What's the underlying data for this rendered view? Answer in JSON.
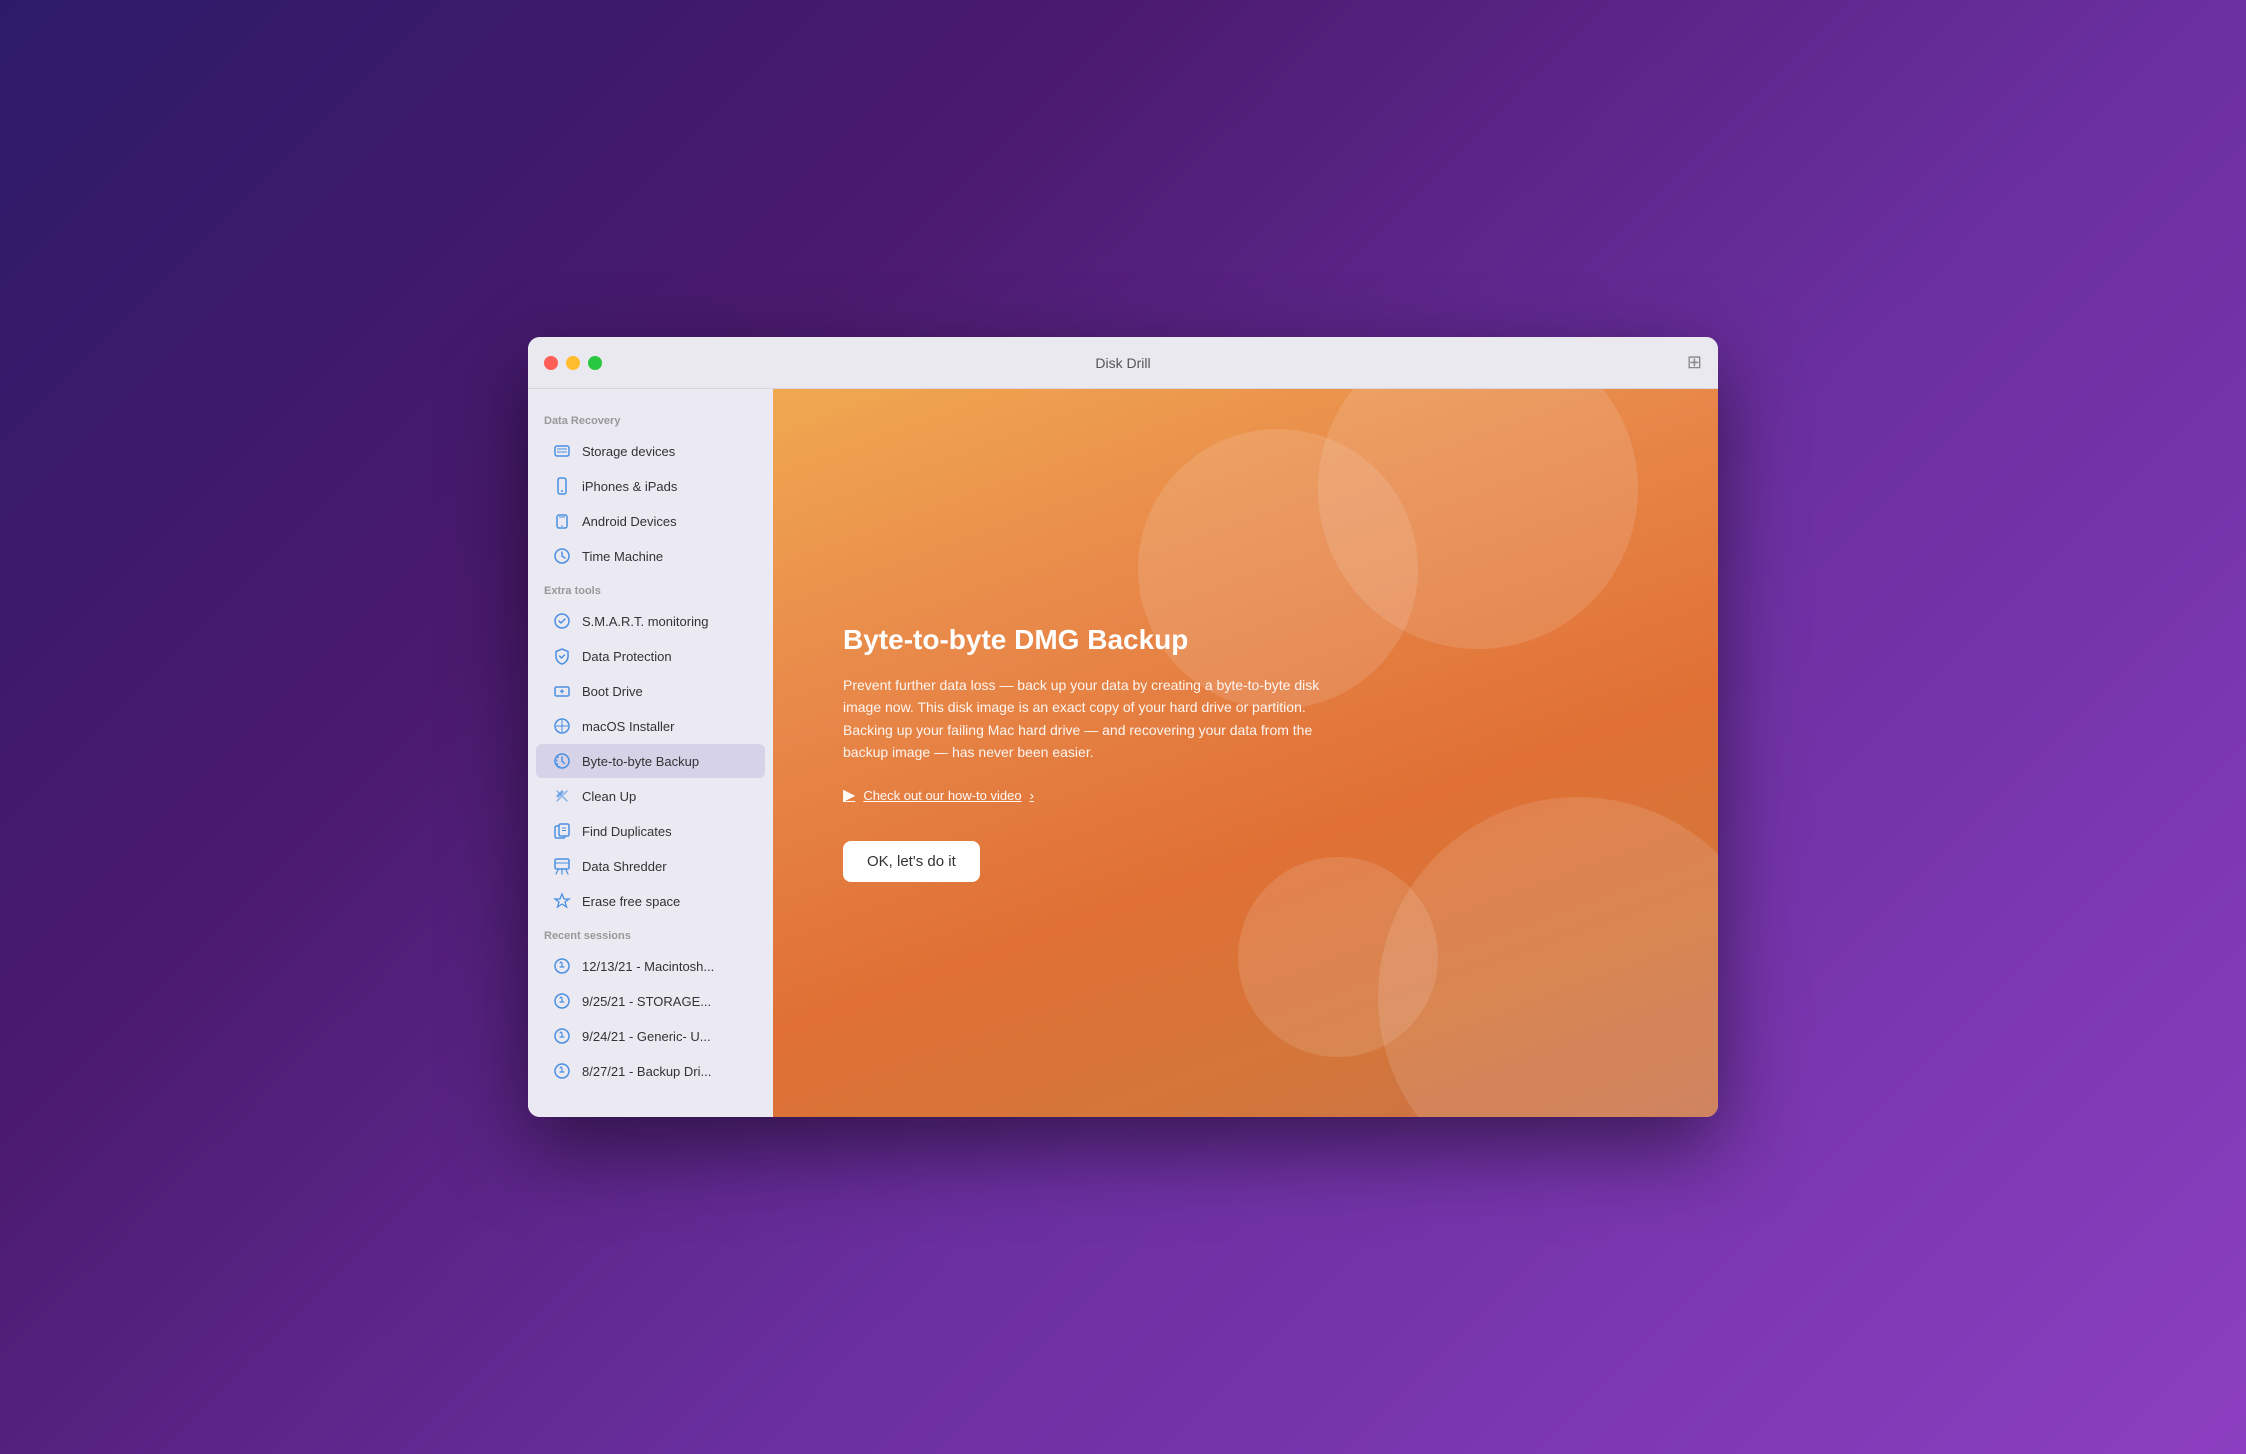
{
  "window": {
    "title": "Disk Drill"
  },
  "titlebar": {
    "title": "Disk Drill",
    "icon": "📖"
  },
  "sidebar": {
    "sections": [
      {
        "label": "Data Recovery",
        "items": [
          {
            "id": "storage-devices",
            "label": "Storage devices",
            "icon": "🖥",
            "active": false
          },
          {
            "id": "iphones-ipads",
            "label": "iPhones & iPads",
            "icon": "📱",
            "active": false
          },
          {
            "id": "android-devices",
            "label": "Android Devices",
            "icon": "📱",
            "active": false
          },
          {
            "id": "time-machine",
            "label": "Time Machine",
            "icon": "🕰",
            "active": false
          }
        ]
      },
      {
        "label": "Extra tools",
        "items": [
          {
            "id": "smart-monitoring",
            "label": "S.M.A.R.T. monitoring",
            "icon": "⚙",
            "active": false
          },
          {
            "id": "data-protection",
            "label": "Data Protection",
            "icon": "🛡",
            "active": false
          },
          {
            "id": "boot-drive",
            "label": "Boot Drive",
            "icon": "💾",
            "active": false
          },
          {
            "id": "macos-installer",
            "label": "macOS Installer",
            "icon": "⊗",
            "active": false
          },
          {
            "id": "byte-to-byte-backup",
            "label": "Byte-to-byte Backup",
            "icon": "🕐",
            "active": true
          },
          {
            "id": "clean-up",
            "label": "Clean Up",
            "icon": "✦",
            "active": false
          },
          {
            "id": "find-duplicates",
            "label": "Find Duplicates",
            "icon": "📋",
            "active": false
          },
          {
            "id": "data-shredder",
            "label": "Data Shredder",
            "icon": "📋",
            "active": false
          },
          {
            "id": "erase-free-space",
            "label": "Erase free space",
            "icon": "⚡",
            "active": false
          }
        ]
      },
      {
        "label": "Recent sessions",
        "items": [
          {
            "id": "session-1",
            "label": "12/13/21 - Macintosh...",
            "icon": "⚙",
            "active": false
          },
          {
            "id": "session-2",
            "label": "9/25/21 - STORAGE...",
            "icon": "⚙",
            "active": false
          },
          {
            "id": "session-3",
            "label": "9/24/21 - Generic- U...",
            "icon": "⚙",
            "active": false
          },
          {
            "id": "session-4",
            "label": "8/27/21 - Backup Dri...",
            "icon": "⚙",
            "active": false
          }
        ]
      }
    ]
  },
  "main_panel": {
    "title": "Byte-to-byte DMG Backup",
    "description": "Prevent further data loss — back up your data by creating a byte-to-byte disk image now. This disk image is an exact copy of your hard drive or partition. Backing up your failing Mac hard drive — and recovering your data from the backup image — has never been easier.",
    "video_link_text": "Check out our how-to video",
    "cta_button_label": "OK, let's do it"
  }
}
